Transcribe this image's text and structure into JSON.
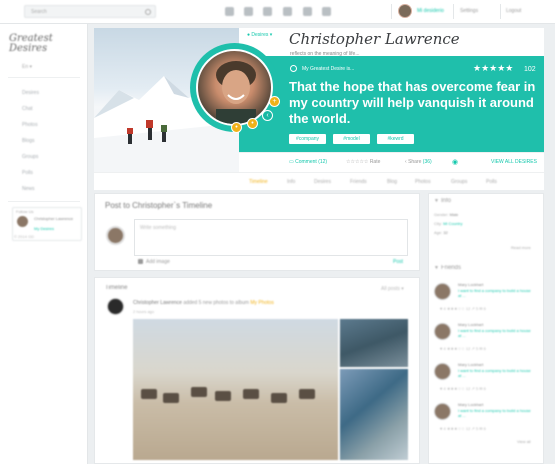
{
  "topbar": {
    "search_placeholder": "Search",
    "nav_icons": [
      "chat-icon",
      "search-icon",
      "bell-icon",
      "gear-icon",
      "grid-icon",
      "home-icon"
    ],
    "username": "Mi desiderio",
    "link_settings": "Settings",
    "link_logout": "Logout"
  },
  "sidebar": {
    "logo": "Greatest Desires",
    "language": "En ▾",
    "items": [
      "Desires",
      "Chat",
      "Photos",
      "Blogs",
      "Groups",
      "Polls",
      "News"
    ],
    "follow": {
      "title": "Follow Us",
      "name": "Christopher Lawrence",
      "desc": "My Desires"
    },
    "footer": "© 2014 GD"
  },
  "header": {
    "tag": "● Desires ▾",
    "name": "Christopher Lawrence",
    "subtitle": "reflects on the meaning of life...",
    "desire_label": "My Greatest Desire is...",
    "stars": "★★★★★",
    "rating": "102",
    "quote": "That the hope that has overcome fear in my country will help vanquish it around the world.",
    "hashtags": [
      "#company",
      "#model",
      "#kewrd"
    ],
    "actions": {
      "comment": "Comment",
      "comment_count": "(12)",
      "rate_stars": "☆☆☆☆☆",
      "rate": "Rate",
      "share": "Share",
      "share_count": "(36)",
      "view_all": "VIEW ALL DESIRES"
    }
  },
  "tabs": [
    "Timeline",
    "Info",
    "Desires",
    "Friends",
    "Blog",
    "Photos",
    "Groups",
    "Polls"
  ],
  "post": {
    "title": "Post to Christopher`s Timeline",
    "placeholder": "Write something",
    "attach": "Add image",
    "submit": "Post"
  },
  "timeline": {
    "title": "Timeline",
    "filter": "All posts ▾",
    "author": "Christopher Lawrence",
    "action": "added 5 new photos to album",
    "album": "My Photos",
    "time": "2 hours ago"
  },
  "info": {
    "title": "Info",
    "rows": [
      {
        "label": "Gender:",
        "value": "Male"
      },
      {
        "label": "City:",
        "value": "Mi Country"
      },
      {
        "label": "Age:",
        "value": "32"
      }
    ],
    "read_more": "Read more"
  },
  "friends": {
    "title": "Friends",
    "items": [
      {
        "name": "Mary Lockhart",
        "desc": "I want to find a company to build a house at ...",
        "stats": "♥ 4   ★★★☆☆ 12   ↗ 5   ✉ 6"
      },
      {
        "name": "Mary Lockhart",
        "desc": "I want to find a company to build a house at ...",
        "stats": "♥ 4   ★★★☆☆ 12   ↗ 5   ✉ 6"
      },
      {
        "name": "Mary Lockhart",
        "desc": "I want to find a company to build a house at ...",
        "stats": "♥ 4   ★★★☆☆ 12   ↗ 5   ✉ 6"
      },
      {
        "name": "Mary Lockhart",
        "desc": "I want to find a company to build a house at ...",
        "stats": "♥ 4   ★★★☆☆ 12   ↗ 5   ✉ 6"
      }
    ],
    "view_all": "View all"
  },
  "colors": {
    "accent": "#1fbfab",
    "highlight": "#f0b21a"
  }
}
